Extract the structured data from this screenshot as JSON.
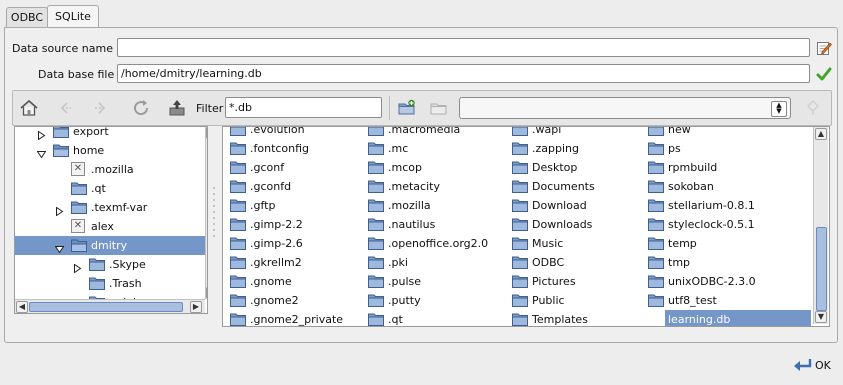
{
  "tabs": [
    {
      "label": "ODBC",
      "active": false
    },
    {
      "label": "SQLite",
      "active": true
    }
  ],
  "form": {
    "dsn_label": "Data source name",
    "dsn_value": "",
    "db_label": "Data base file",
    "db_value": "/home/dmitry/learning.db"
  },
  "toolbar": {
    "filter_label": "Filter",
    "filter_value": "*.db",
    "path_select": ""
  },
  "tree": [
    {
      "label": "export",
      "depth": 1,
      "expander": "collapsed",
      "icon": "folder",
      "selected": false
    },
    {
      "label": "home",
      "depth": 1,
      "expander": "expanded",
      "icon": "folder-open",
      "selected": false
    },
    {
      "label": ".mozilla",
      "depth": 2,
      "expander": "none",
      "icon": "locked-folder",
      "selected": false
    },
    {
      "label": ".qt",
      "depth": 2,
      "expander": "none",
      "icon": "folder",
      "selected": false
    },
    {
      "label": ".texmf-var",
      "depth": 2,
      "expander": "collapsed",
      "icon": "folder",
      "selected": false
    },
    {
      "label": "alex",
      "depth": 2,
      "expander": "none",
      "icon": "locked-folder",
      "selected": false
    },
    {
      "label": "dmitry",
      "depth": 2,
      "expander": "expanded",
      "icon": "folder-open",
      "selected": true
    },
    {
      "label": ".Skype",
      "depth": 3,
      "expander": "collapsed",
      "icon": "folder",
      "selected": false
    },
    {
      "label": ".Trash",
      "depth": 3,
      "expander": "none",
      "icon": "folder",
      "selected": false
    },
    {
      "label": ".adobe",
      "depth": 3,
      "expander": "collapsed",
      "icon": "folder",
      "selected": false
    }
  ],
  "files": {
    "columns": [
      [
        ".evolution",
        ".fontconfig",
        ".gconf",
        ".gconfd",
        ".gftp",
        ".gimp-2.2",
        ".gimp-2.6",
        ".gkrellm2",
        ".gnome",
        ".gnome2",
        ".gnome2_private"
      ],
      [
        ".macromedia",
        ".mc",
        ".mcop",
        ".metacity",
        ".mozilla",
        ".nautilus",
        ".openoffice.org2.0",
        ".pki",
        ".pulse",
        ".putty",
        ".qt"
      ],
      [
        ".wapi",
        ".zapping",
        "Desktop",
        "Documents",
        "Download",
        "Downloads",
        "Music",
        "ODBC",
        "Pictures",
        "Public",
        "Templates"
      ],
      [
        "new",
        "ps",
        "rpmbuild",
        "sokoban",
        "stellarium-0.8.1",
        "styleclock-0.5.1",
        "temp",
        "tmp",
        "unixODBC-2.3.0",
        "utf8_test",
        "learning.db"
      ]
    ],
    "selected": "learning.db"
  },
  "ok_label": "OK"
}
